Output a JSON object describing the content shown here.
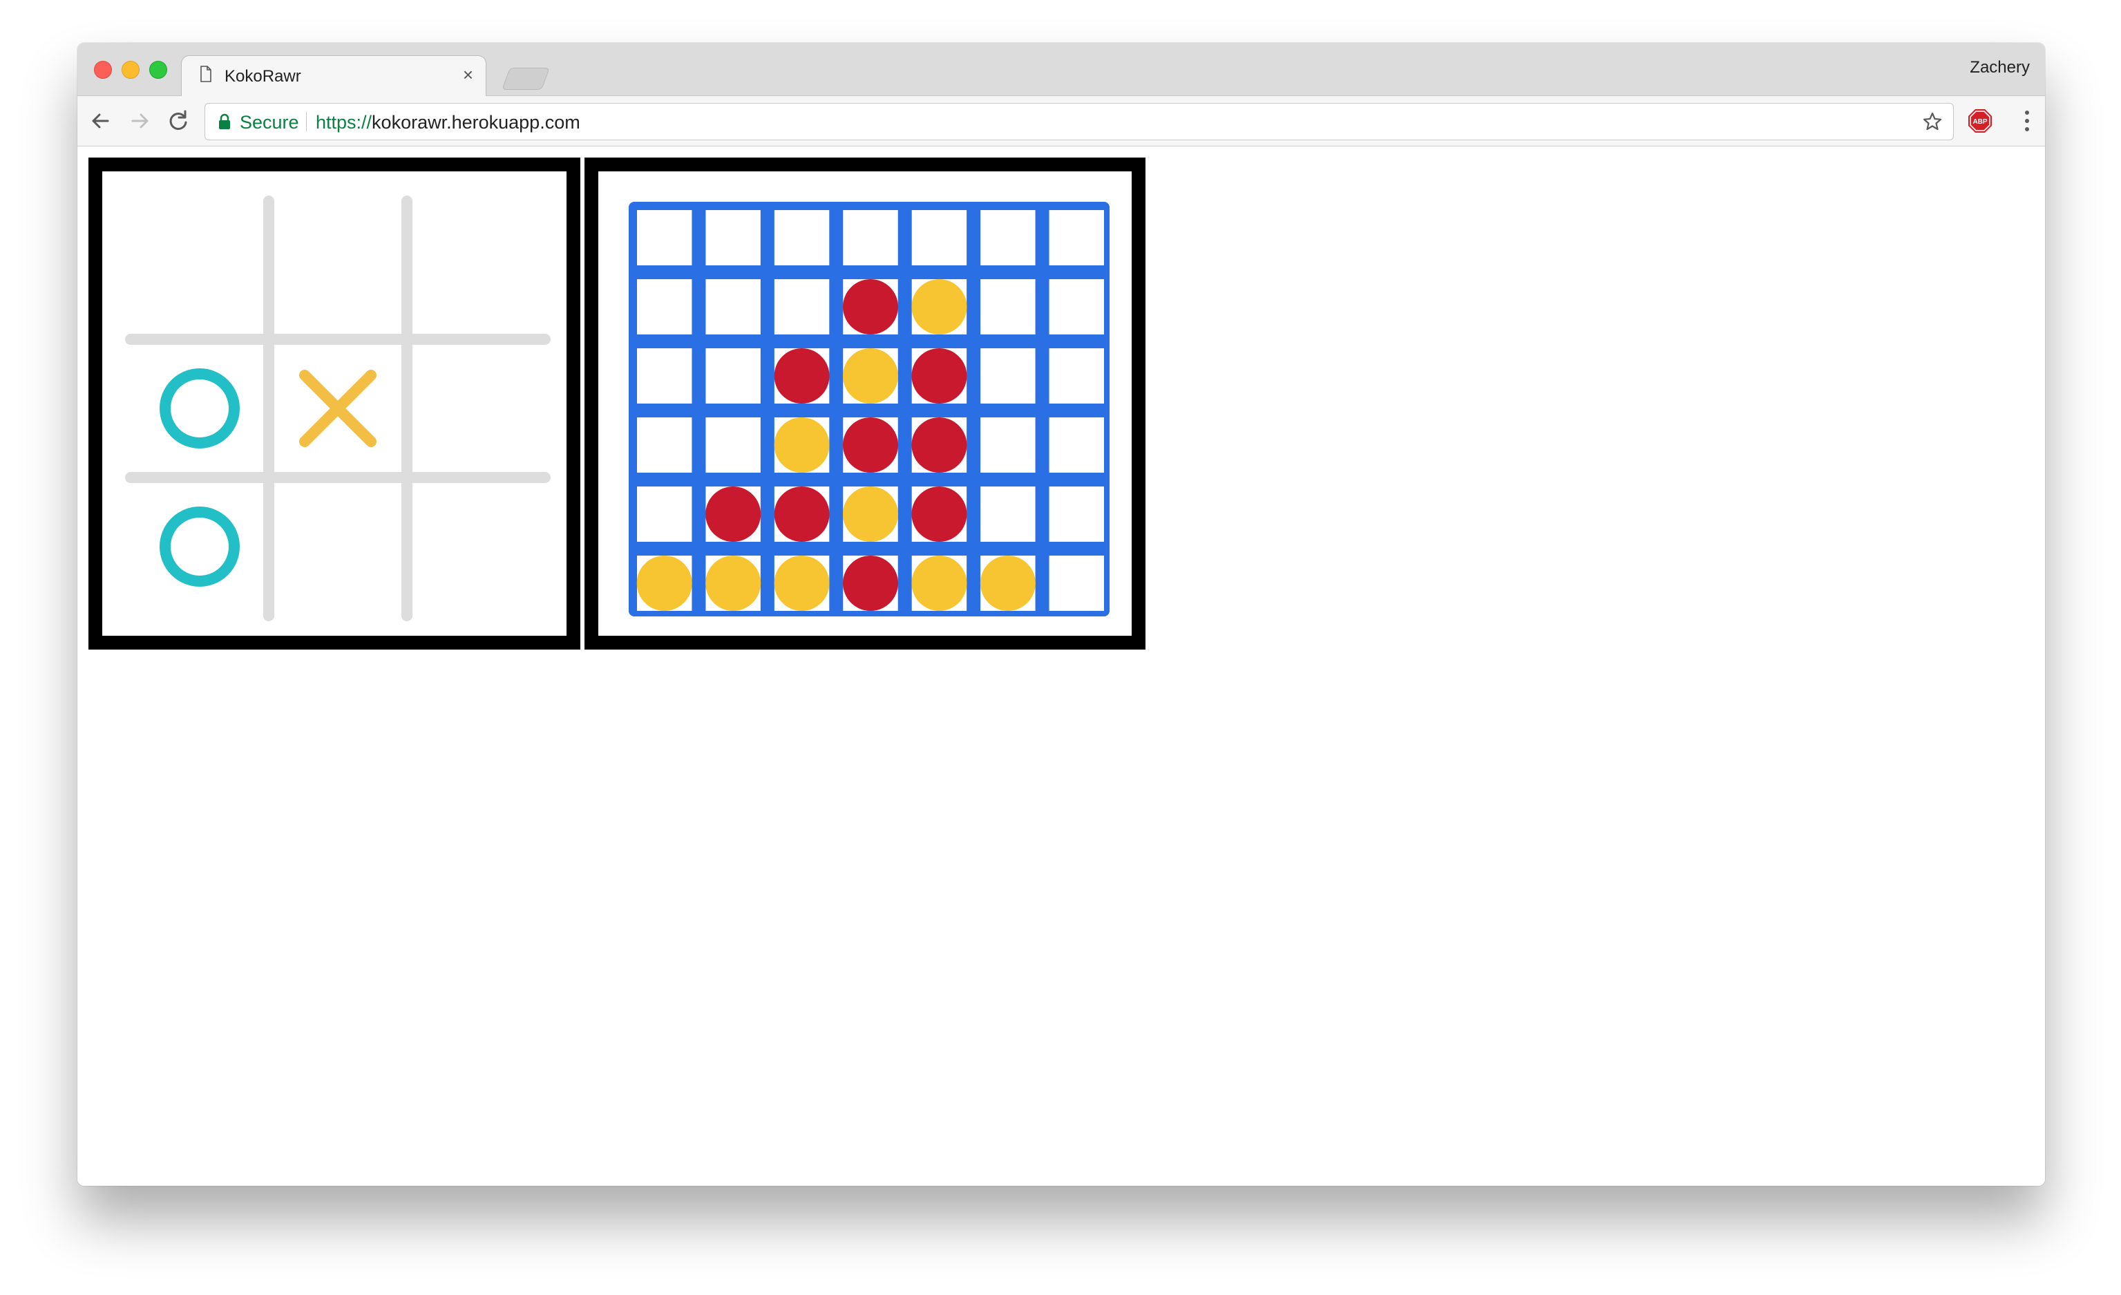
{
  "browser": {
    "tab_title": "KokoRawr",
    "tab_close_glyph": "×",
    "profile_name": "Zachery",
    "secure_label": "Secure",
    "url_scheme": "https://",
    "url_host": "kokorawr.herokuapp.com"
  },
  "icons": {
    "back": "back-arrow-icon",
    "forward": "forward-arrow-icon",
    "reload": "reload-icon",
    "lock": "lock-icon",
    "bookmark": "star-icon",
    "adblock": "adblock-plus-icon",
    "menu": "more-vert-icon",
    "page": "page-icon"
  },
  "colors": {
    "o_mark": "#22bfc7",
    "x_mark": "#f2be43",
    "ttt_grid": "#dddddd",
    "c4_board": "#2a6fe3",
    "c4_red": "#c8192e",
    "c4_yellow": "#f7c531",
    "secure_green": "#0b8043"
  },
  "tictactoe": {
    "board": [
      [
        "",
        "",
        ""
      ],
      [
        "O",
        "X",
        ""
      ],
      [
        "O",
        "",
        ""
      ]
    ]
  },
  "connect_four": {
    "columns": 7,
    "rows": 6,
    "board": [
      [
        "",
        "",
        "",
        "",
        "",
        "",
        ""
      ],
      [
        "",
        "",
        "",
        "R",
        "Y",
        "",
        ""
      ],
      [
        "",
        "",
        "R",
        "Y",
        "R",
        "",
        ""
      ],
      [
        "",
        "",
        "Y",
        "R",
        "R",
        "",
        ""
      ],
      [
        "",
        "R",
        "R",
        "Y",
        "R",
        "",
        ""
      ],
      [
        "Y",
        "Y",
        "Y",
        "R",
        "Y",
        "Y",
        ""
      ]
    ]
  }
}
